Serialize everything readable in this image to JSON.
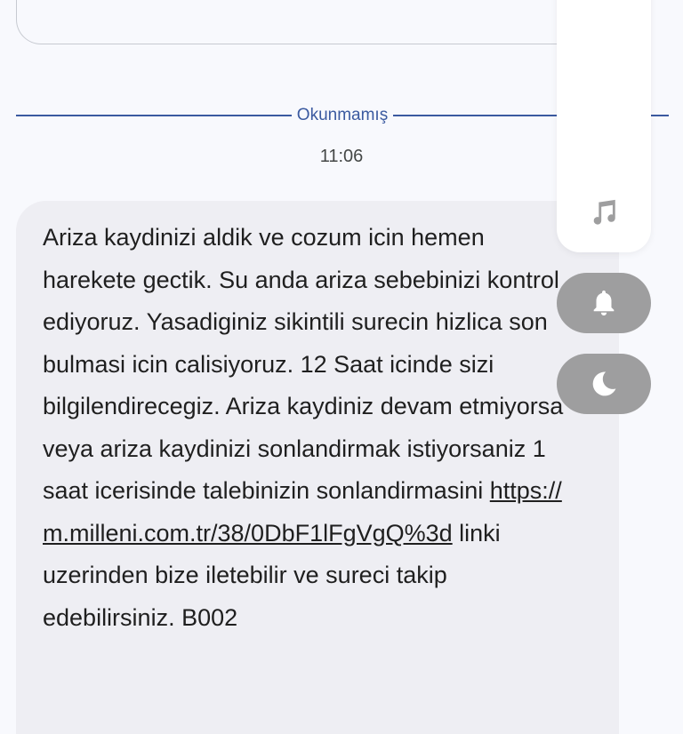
{
  "divider": {
    "label": "Okunmamış"
  },
  "message": {
    "time": "11:06",
    "text_before_link": "Ariza kaydinizi aldik ve cozum icin hemen harekete gectik. Su anda ariza sebebinizi kontrol ediyoruz. Yasadiginiz sikintili surecin hizlica son bulmasi icin calisiyoruz. 12 Saat icinde sizi bilgilendirecegiz. Ariza kaydiniz devam etmiyorsa veya ariza kaydinizi sonlandirmak istiyorsaniz 1 saat icerisinde talebinizin sonlandirmasini ",
    "link": "https://m.milleni.com.tr/38/0DbF1lFgVgQ%3d",
    "text_after_link": " linki uzerinden bize iletebilir ve sureci takip edebilirsiniz. B002"
  },
  "side_panel": {
    "icons": [
      "music-note-icon",
      "bell-icon",
      "moon-icon"
    ],
    "accent": "#9e9e9f"
  },
  "colors": {
    "divider": "#3b5aa0",
    "bubble": "#eeeef3",
    "background": "#f8f9fd"
  }
}
